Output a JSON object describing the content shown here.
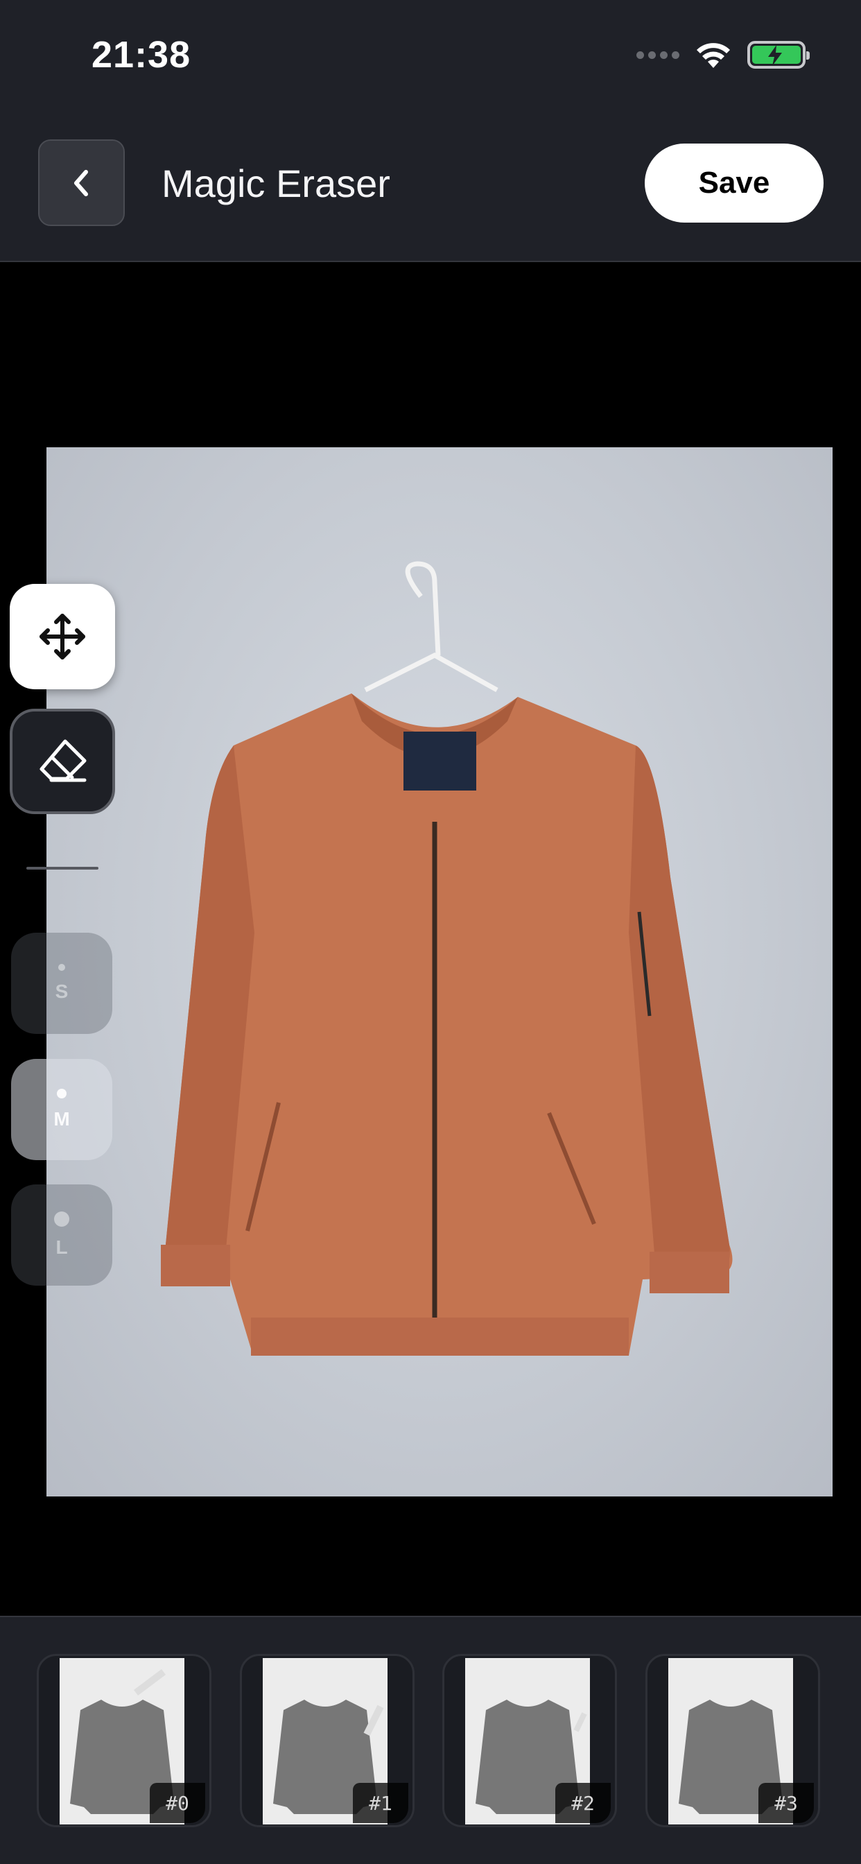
{
  "status_bar": {
    "time": "21:38",
    "icons": [
      "signal-icon",
      "wifi-icon",
      "battery-charging-icon"
    ]
  },
  "header": {
    "back_icon": "chevron-left-icon",
    "title": "Magic Eraser",
    "save_label": "Save"
  },
  "tools": [
    {
      "name": "move",
      "icon": "move-arrows-icon",
      "active": true
    },
    {
      "name": "erase",
      "icon": "eraser-icon",
      "active": false
    }
  ],
  "brush_sizes": [
    {
      "label": "S",
      "selected": false
    },
    {
      "label": "M",
      "selected": true
    },
    {
      "label": "L",
      "selected": false
    }
  ],
  "history": [
    {
      "label": "#0"
    },
    {
      "label": "#1"
    },
    {
      "label": "#2"
    },
    {
      "label": "#3"
    }
  ],
  "colors": {
    "bar_bg": "#1f2128",
    "canvas_bg": "#000000",
    "battery": "#34c759",
    "jacket": "#c47450"
  }
}
